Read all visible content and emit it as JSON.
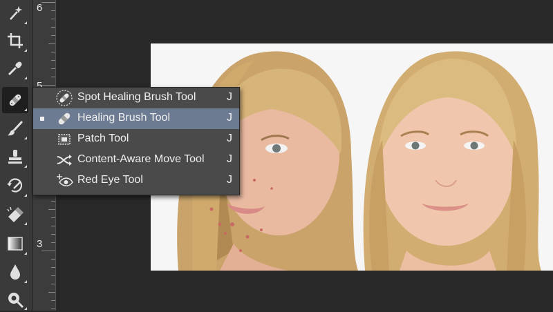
{
  "toolbar": {
    "tools": [
      {
        "name": "magic-wand-icon"
      },
      {
        "name": "crop-icon"
      },
      {
        "name": "eyedropper-icon"
      },
      {
        "name": "healing-brush-icon",
        "active": true
      },
      {
        "name": "brush-icon"
      },
      {
        "name": "clone-stamp-icon"
      },
      {
        "name": "history-brush-icon"
      },
      {
        "name": "eraser-icon"
      },
      {
        "name": "gradient-icon"
      },
      {
        "name": "blur-icon"
      },
      {
        "name": "dodge-icon"
      }
    ]
  },
  "ruler": {
    "labels": [
      "6",
      "5",
      "3"
    ]
  },
  "flyout": {
    "items": [
      {
        "label": "Spot Healing Brush Tool",
        "shortcut": "J",
        "icon": "spot-healing-brush-icon",
        "selected": false
      },
      {
        "label": "Healing Brush Tool",
        "shortcut": "J",
        "icon": "healing-brush-icon",
        "selected": true
      },
      {
        "label": "Patch Tool",
        "shortcut": "J",
        "icon": "patch-icon",
        "selected": false
      },
      {
        "label": "Content-Aware Move Tool",
        "shortcut": "J",
        "icon": "content-aware-move-icon",
        "selected": false
      },
      {
        "label": "Red Eye Tool",
        "shortcut": "J",
        "icon": "red-eye-icon",
        "selected": false
      }
    ]
  },
  "canvas": {
    "image": "before-after-portrait"
  },
  "colors": {
    "panel": "#3a3a3a",
    "canvas": "#282828",
    "menu": "#4a4a4a",
    "menu_selected": "#6c7b92"
  }
}
